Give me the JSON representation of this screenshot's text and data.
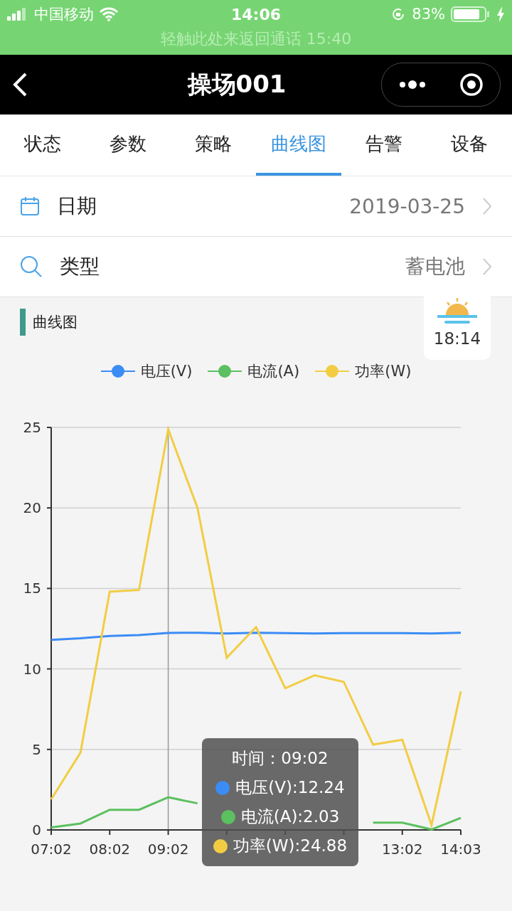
{
  "status_bar": {
    "carrier": "中国移动",
    "time": "14:06",
    "battery": "83%",
    "call_banner": "轻触此处来返回通话 15:40"
  },
  "nav": {
    "title": "操场001"
  },
  "tabs": [
    {
      "label": "状态",
      "selected": false
    },
    {
      "label": "参数",
      "selected": false
    },
    {
      "label": "策略",
      "selected": false
    },
    {
      "label": "曲线图",
      "selected": true
    },
    {
      "label": "告警",
      "selected": false
    },
    {
      "label": "设备",
      "selected": false
    }
  ],
  "filters": [
    {
      "kind": "date",
      "label": "日期",
      "value": "2019-03-25"
    },
    {
      "kind": "search",
      "label": "类型",
      "value": "蓄电池"
    }
  ],
  "section": {
    "title": "曲线图"
  },
  "sunset_badge": {
    "time": "18:14"
  },
  "chart": {
    "chart_data": {
      "type": "line",
      "categories": [
        "07:02",
        null,
        "08:02",
        null,
        "09:02",
        null,
        null,
        null,
        null,
        null,
        null,
        null,
        "13:02",
        null,
        "14:03"
      ],
      "ylim": [
        0,
        25
      ],
      "yticks": [
        0,
        5,
        10,
        15,
        20,
        25
      ],
      "grid": true,
      "series": [
        {
          "name": "电压(V)",
          "color": "#3b8cf5",
          "values": [
            11.8,
            11.9,
            12.05,
            12.1,
            12.24,
            12.25,
            12.2,
            12.25,
            12.22,
            12.2,
            12.22,
            12.22,
            12.22,
            12.2,
            12.25
          ]
        },
        {
          "name": "电流(A)",
          "color": "#5cc060",
          "values": [
            0.15,
            0.4,
            1.25,
            1.25,
            2.03,
            1.65,
            null,
            null,
            null,
            null,
            null,
            0.45,
            0.45,
            0.03,
            0.75
          ]
        },
        {
          "name": "功率(W)",
          "color": "#f2cd44",
          "values": [
            1.9,
            4.8,
            14.8,
            14.9,
            24.88,
            20,
            10.7,
            12.6,
            8.8,
            9.6,
            9.2,
            5.3,
            5.6,
            0.3,
            8.6
          ]
        }
      ]
    },
    "tooltip": {
      "title": "时间：09:02",
      "items": [
        {
          "text": "电压(V):12.24",
          "color": "#3b8cf5"
        },
        {
          "text": "电流(A):2.03",
          "color": "#5cc060"
        },
        {
          "text": "功率(W):24.88",
          "color": "#f2cd44"
        }
      ]
    }
  }
}
